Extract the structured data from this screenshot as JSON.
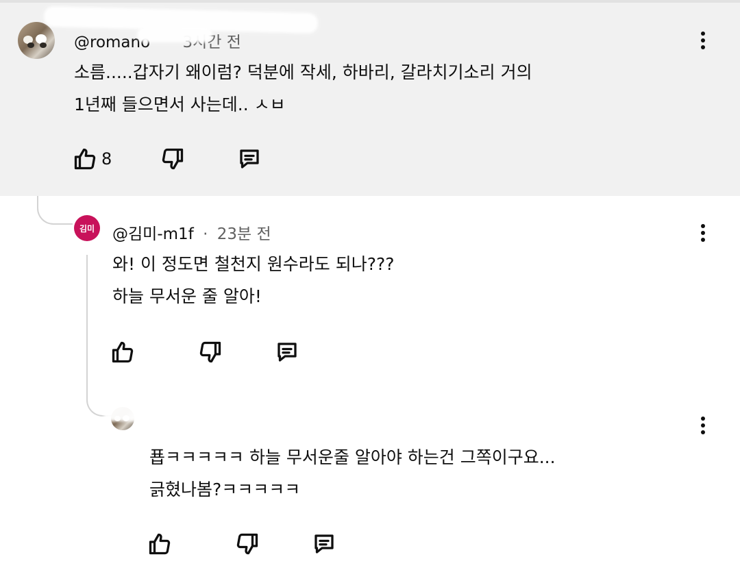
{
  "comments": [
    {
      "handle": "@romano",
      "time": "3시간 전",
      "lines": [
        "소름.....갑자기 왜이럼? 덕분에 작세, 하바리, 갈라치기소리 거의",
        "1년째 들으면서 사는데.. ㅅㅂ"
      ],
      "likes": "8"
    },
    {
      "avatar_text": "김미",
      "handle": "@김미-m1f",
      "separator": "·",
      "time": "23분 전",
      "lines": [
        "와! 이 정도면 철천지 원수라도 되나???",
        "하늘 무서운 줄 알아!"
      ],
      "likes": ""
    },
    {
      "handle": "",
      "time": "",
      "lines": [
        "푭ㅋㅋㅋㅋㅋ 하늘 무서운줄 알아야 하는건 그쪽이구요...",
        "긁혔나봄?ㅋㅋㅋㅋㅋ"
      ],
      "likes": ""
    }
  ],
  "icons": {
    "like": "thumbs-up-icon",
    "dislike": "thumbs-down-icon",
    "reply": "reply-icon",
    "menu": "more-vert-icon"
  },
  "colors": {
    "highlight_bg": "#f1f1f1",
    "avatar_accent": "#c8125a",
    "text": "#0f0f0f",
    "meta": "#606060"
  }
}
